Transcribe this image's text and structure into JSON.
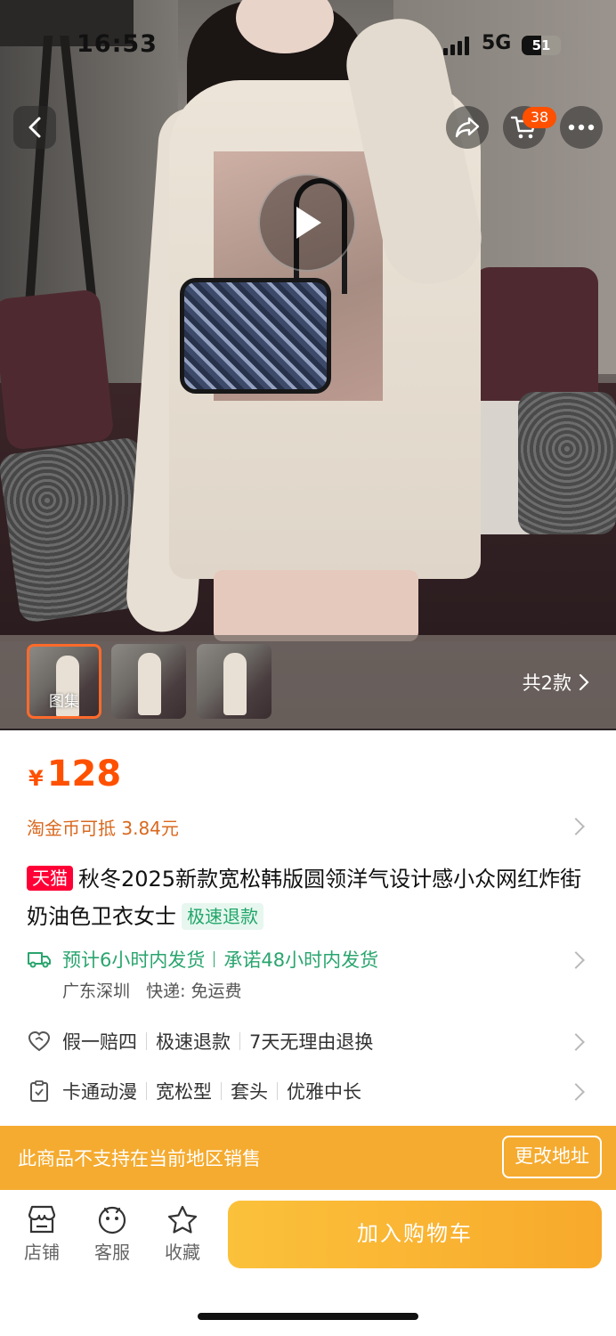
{
  "status_bar": {
    "time": "16:53",
    "network": "5G",
    "battery": "51",
    "battery_level": 0.51
  },
  "top_actions": {
    "cart_badge": "38"
  },
  "gallery": {
    "thumbnails": [
      {
        "label": "图集",
        "selected": true
      },
      {
        "label": "",
        "selected": false
      },
      {
        "label": "",
        "selected": false
      }
    ],
    "styles_count": "共2款"
  },
  "product": {
    "currency": "¥",
    "price": "128",
    "coin_discount": "淘金币可抵 3.84元",
    "store_badge": "天猫",
    "title": "秋冬2025新款宽松韩版圆领洋气设计感小众网红炸街奶油色卫衣女士",
    "title_tag": "极速退款"
  },
  "delivery": {
    "estimate": "预计6小时内发货",
    "promise": "承诺48小时内发货",
    "origin": "广东深圳",
    "shipping": "快递: 免运费"
  },
  "guarantees": [
    "假一赔四",
    "极速退款",
    "7天无理由退换"
  ],
  "specs": [
    "卡通动漫",
    "宽松型",
    "套头",
    "优雅中长"
  ],
  "banner": {
    "message": "此商品不支持在当前地区销售",
    "action": "更改地址"
  },
  "bottom_bar": {
    "tabs": [
      {
        "label": "店铺",
        "icon": "store-icon"
      },
      {
        "label": "客服",
        "icon": "service-icon"
      },
      {
        "label": "收藏",
        "icon": "star-icon"
      }
    ],
    "add_to_cart": "加入购物车"
  },
  "colors": {
    "accent": "#ff5000",
    "banner": "#f5ab2f",
    "tmall": "#ff0036",
    "green": "#2aa56e"
  }
}
